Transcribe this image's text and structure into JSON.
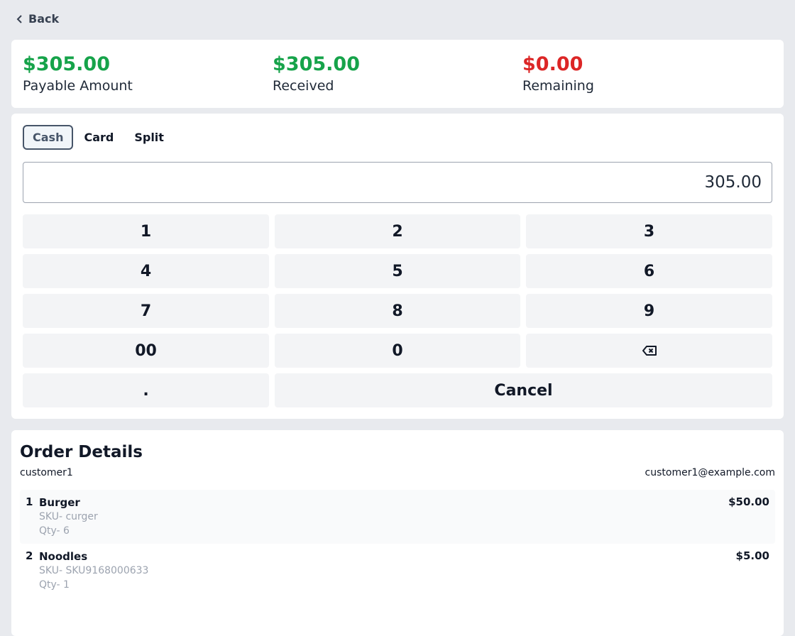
{
  "nav": {
    "back_label": "Back"
  },
  "summary": {
    "payable": {
      "amount": "$305.00",
      "label": "Payable Amount"
    },
    "received": {
      "amount": "$305.00",
      "label": "Received"
    },
    "remaining": {
      "amount": "$0.00",
      "label": "Remaining"
    }
  },
  "payment": {
    "tabs": [
      {
        "label": "Cash",
        "active": true
      },
      {
        "label": "Card",
        "active": false
      },
      {
        "label": "Split",
        "active": false
      }
    ],
    "amount_value": "305.00",
    "keys": [
      "1",
      "2",
      "3",
      "4",
      "5",
      "6",
      "7",
      "8",
      "9",
      "00",
      "0",
      "backspace-icon",
      ".",
      "Cancel"
    ]
  },
  "order": {
    "title": "Order Details",
    "customer_name": "customer1",
    "customer_email": "customer1@example.com",
    "items": [
      {
        "index": "1",
        "name": "Burger",
        "sku": "SKU- curger",
        "qty": "Qty- 6",
        "price": "$50.00"
      },
      {
        "index": "2",
        "name": "Noodles",
        "sku": "SKU- SKU9168000633",
        "qty": "Qty- 1",
        "price": "$5.00"
      }
    ]
  },
  "colors": {
    "positive": "#16a34a",
    "negative": "#dc2626",
    "accent": "#475569"
  }
}
